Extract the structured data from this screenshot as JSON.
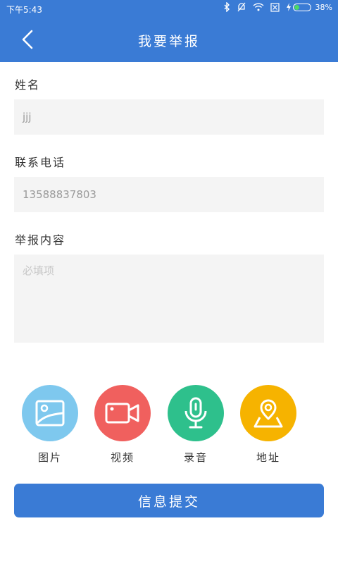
{
  "status_bar": {
    "time": "下午5:43",
    "battery_percent": "38%",
    "battery_level": 0.38
  },
  "header": {
    "title": "我要举报",
    "back_icon": "chevron-left-icon"
  },
  "form": {
    "name_label": "姓名",
    "name_value": "jjj",
    "phone_label": "联系电话",
    "phone_value": "13588837803",
    "content_label": "举报内容",
    "content_placeholder": "必填项"
  },
  "tools": [
    {
      "label": "图片",
      "icon": "image-icon",
      "color": "#7ec8ee"
    },
    {
      "label": "视频",
      "icon": "video-camera-icon",
      "color": "#f0605e"
    },
    {
      "label": "录音",
      "icon": "microphone-icon",
      "color": "#2ec08c"
    },
    {
      "label": "地址",
      "icon": "location-pin-icon",
      "color": "#f6b300"
    }
  ],
  "submit_label": "信息提交",
  "colors": {
    "primary": "#3a7bd5",
    "field_bg": "#f4f4f4"
  }
}
